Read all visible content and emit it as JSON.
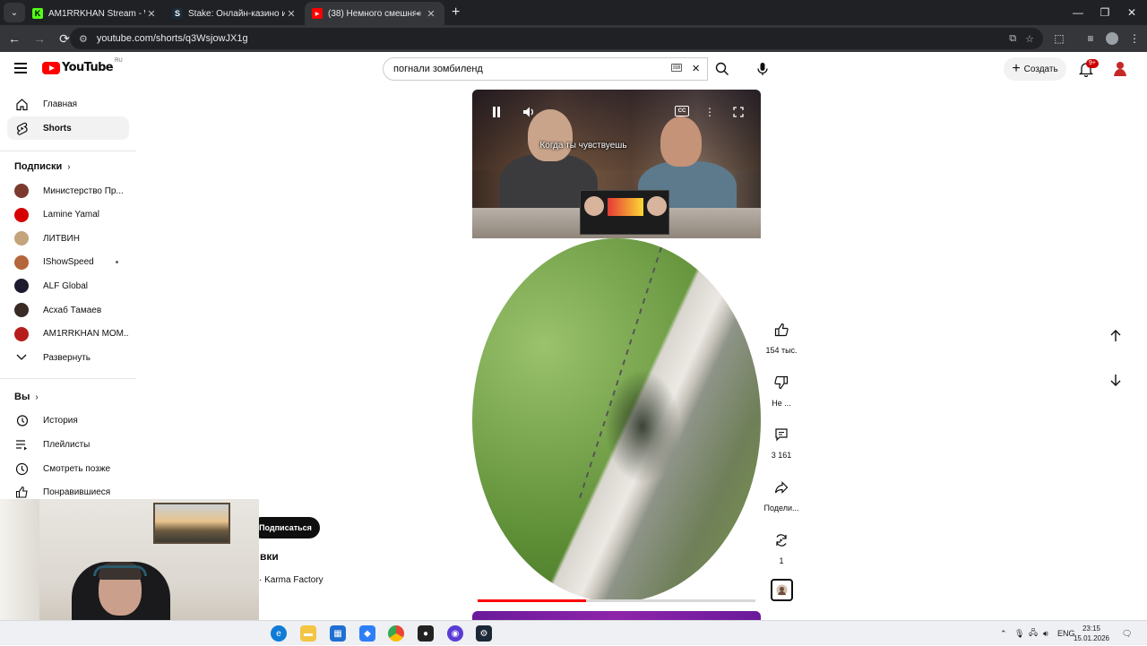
{
  "browser": {
    "tabs": [
      {
        "label": "AM1RRKHAN Stream - Watch L",
        "favicon": "K",
        "favicon_color": "#53fc18"
      },
      {
        "label": "Stake: Онлайн-казино и ставк",
        "favicon": "S",
        "favicon_color": "#1a2c38"
      },
      {
        "label": "(38) Немного смешнявки",
        "favicon": "▶",
        "favicon_color": "#ff0000"
      }
    ],
    "url": "youtube.com/shorts/q3WsjowJX1g"
  },
  "header": {
    "logo": "YouTube",
    "region": "RU",
    "search_value": "погнали зомбиленд",
    "create_label": "Создать",
    "notifications_badge": "9+"
  },
  "sidebar": {
    "main": [
      {
        "label": "Главная",
        "icon": "home-icon"
      },
      {
        "label": "Shorts",
        "icon": "shorts-icon"
      }
    ],
    "subscriptions_title": "Подписки",
    "subscriptions": [
      {
        "label": "Министерство Пр...",
        "color": "#7a3b2e"
      },
      {
        "label": "Lamine Yamal",
        "color": "#d60000"
      },
      {
        "label": "ЛИТВИН",
        "color": "#c4a47c"
      },
      {
        "label": "IShowSpeed",
        "color": "#b5653a"
      },
      {
        "label": "ALF Global",
        "color": "#1d1a2f"
      },
      {
        "label": "Асхаб Тамаев",
        "color": "#3a2a25"
      },
      {
        "label": "AM1RRKHAN MOM...",
        "color": "#b71c1c"
      }
    ],
    "expand_label": "Развернуть",
    "you_title": "Вы",
    "you_items": [
      {
        "label": "История",
        "icon": "history-icon"
      },
      {
        "label": "Плейлисты",
        "icon": "playlists-icon"
      },
      {
        "label": "Смотреть позже",
        "icon": "watch-later-icon"
      },
      {
        "label": "Понравившиеся",
        "icon": "liked-icon"
      }
    ]
  },
  "player": {
    "caption": "Когда ты чувствуешь",
    "cc_label": "CC",
    "progress": 0.39,
    "title_fragment": "вки",
    "music_fragment": "· Karma Factory",
    "subscribe_label": "Подписаться"
  },
  "actions": {
    "likes": "154 тыс.",
    "dislike": "Не ...",
    "comments": "3 161",
    "share": "Подели...",
    "remix": "1"
  },
  "taskbar": {
    "lang": "ENG",
    "time": "23:15",
    "date": "15.01.2026"
  }
}
